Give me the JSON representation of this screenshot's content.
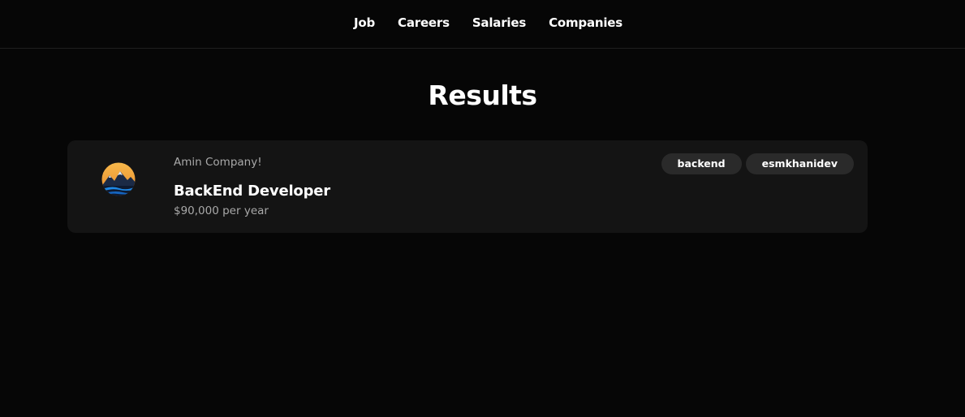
{
  "nav": {
    "items": [
      {
        "label": "Job"
      },
      {
        "label": "Careers"
      },
      {
        "label": "Salaries"
      },
      {
        "label": "Companies"
      }
    ]
  },
  "page": {
    "title": "Results"
  },
  "results": [
    {
      "company": "Amin Company!",
      "title": "BackEnd Developer",
      "salary": "$90,000 per year",
      "logo_icon": "mountain-sunset-logo-icon",
      "tags": [
        "backend",
        "esmkhanidev"
      ]
    }
  ],
  "colors": {
    "background": "#060606",
    "card": "#141414",
    "tag": "#2a2a2a",
    "muted_text": "#a9a9a9",
    "logo_sun": "#f4a63a",
    "logo_water": "#1e88e5"
  }
}
